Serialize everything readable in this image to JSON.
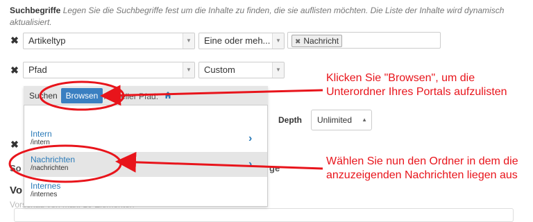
{
  "header": {
    "title": "Suchbegriffe",
    "description": "Legen Sie die Suchbegriffe fest um die Inhalte zu finden, die sie auflisten möchten. Die Liste der Inhalte wird dynamisch aktualisiert."
  },
  "criteria": [
    {
      "field": "Artikeltyp",
      "operator": "Eine oder meh...",
      "value_token": "Nachricht"
    },
    {
      "field": "Pfad",
      "operator": "Custom"
    }
  ],
  "browser": {
    "search_label": "Suchen",
    "browse_label": "Browsen",
    "current_path_label": "Aktueller Pfad:",
    "items": [
      {
        "title": "Intern",
        "path": "/intern"
      },
      {
        "title": "Nachrichten",
        "path": "/nachrichten"
      },
      {
        "title": "Internes",
        "path": "/internes"
      }
    ]
  },
  "depth": {
    "label": "Depth",
    "value": "Unlimited"
  },
  "partial": {
    "sort_fragment": "So",
    "sort_suffix": "ge",
    "section_head": "Vo",
    "section_note": "Vorschau von max. 10 Elementen"
  },
  "annotations": {
    "browse_hint": "Klicken Sie \"Browsen\", um die Unterordner Ihres Portals aufzulisten",
    "folder_hint": "Wählen Sie nun den Ordner in dem die anzuzeigenden Nachrichten liegen aus"
  },
  "colors": {
    "annotation": "#e8141b",
    "primary": "#3a7fc1",
    "link": "#2a7ab8"
  }
}
